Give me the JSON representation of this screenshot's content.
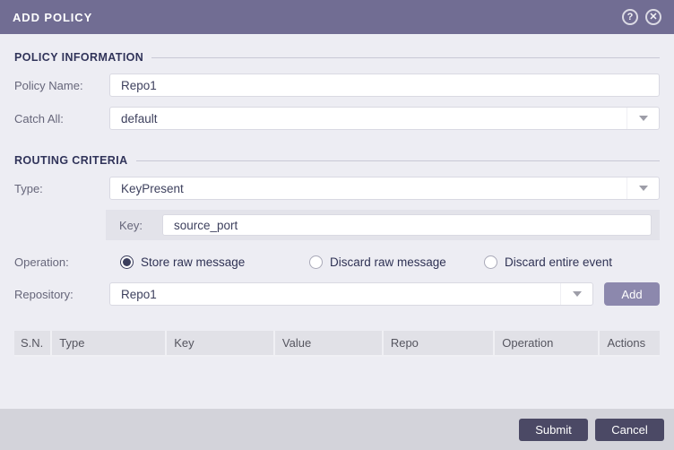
{
  "dialog": {
    "title": "ADD POLICY",
    "help_icon": "?",
    "close_icon": "✕"
  },
  "sections": {
    "policy_information": "POLICY INFORMATION",
    "routing_criteria": "ROUTING CRITERIA"
  },
  "fields": {
    "policy_name": {
      "label": "Policy Name:",
      "value": "Repo1"
    },
    "catch_all": {
      "label": "Catch All:",
      "value": "default"
    },
    "type": {
      "label": "Type:",
      "value": "KeyPresent"
    },
    "key": {
      "label": "Key:",
      "value": "source_port"
    },
    "operation": {
      "label": "Operation:",
      "options": [
        {
          "label": "Store raw message",
          "selected": true
        },
        {
          "label": "Discard raw message",
          "selected": false
        },
        {
          "label": "Discard entire event",
          "selected": false
        }
      ]
    },
    "repository": {
      "label": "Repository:",
      "value": "Repo1",
      "add_button": "Add"
    }
  },
  "table": {
    "headers": [
      "S.N.",
      "Type",
      "Key",
      "Value",
      "Repo",
      "Operation",
      "Actions"
    ],
    "rows": []
  },
  "footer": {
    "submit": "Submit",
    "cancel": "Cancel"
  },
  "colors": {
    "header_bg": "#716D93",
    "page_bg": "#EDEDF3",
    "accent_dark": "#4B4965",
    "accent_light": "#8C88AD",
    "section_title": "#31345A"
  }
}
